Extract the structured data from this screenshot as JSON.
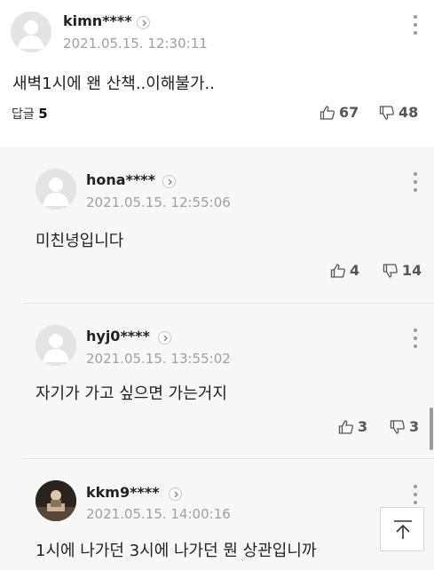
{
  "main_comment": {
    "username": "kimn****",
    "timestamp": "2021.05.15. 12:30:11",
    "text": "새벽1시에 왠 산책..이해불가..",
    "reply_label": "답글",
    "reply_count": "5",
    "likes": "67",
    "dislikes": "48"
  },
  "replies": [
    {
      "username": "hona****",
      "timestamp": "2021.05.15. 12:55:06",
      "text": "미친녕입니다",
      "likes": "4",
      "dislikes": "14"
    },
    {
      "username": "hyj0****",
      "timestamp": "2021.05.15. 13:55:02",
      "text": "자기가 가고 싶으면 가는거지",
      "likes": "3",
      "dislikes": "3"
    },
    {
      "username": "kkm9****",
      "timestamp": "2021.05.15. 14:00:16",
      "text": "1시에 나가던 3시에 나가던 뭔 상관입니까"
    }
  ],
  "colors": {
    "reply_background": "#f7f7f7",
    "text": "#222222",
    "muted": "#a0a0a0"
  },
  "icons": {
    "like": "thumbs-up-icon",
    "dislike": "thumbs-down-icon",
    "more": "more-vertical-icon",
    "profile": "chevron-right-icon",
    "scroll_top": "arrow-up-to-top-icon"
  }
}
